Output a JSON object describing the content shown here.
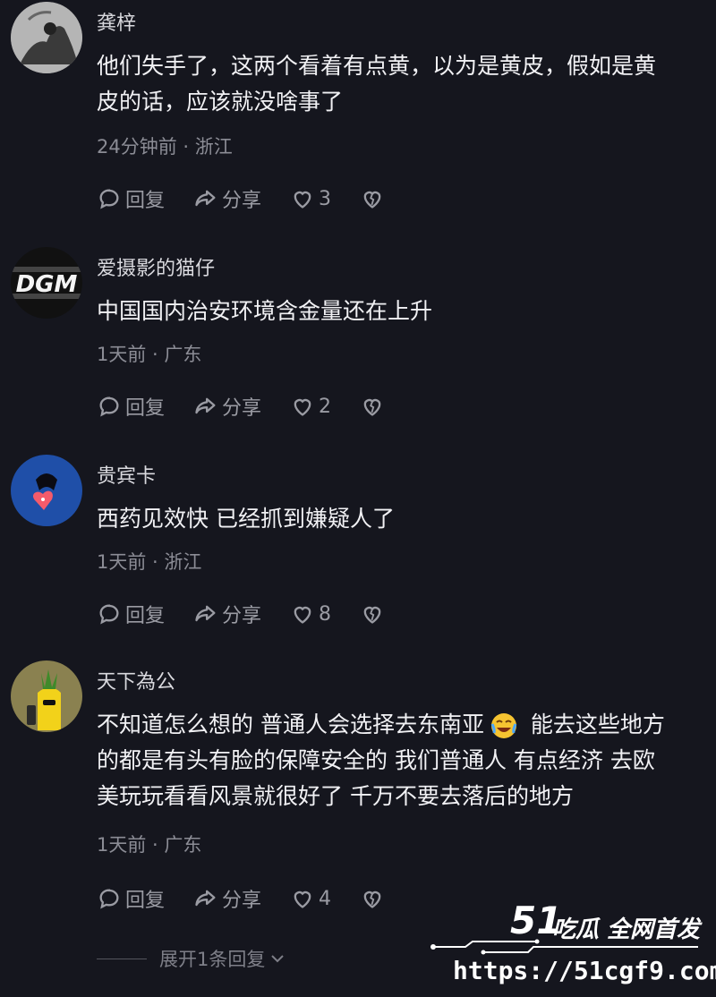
{
  "comments": [
    {
      "username": "龚梓",
      "lines": [
        "他们失手了，这两个看着有点黄，以为是黄皮，假如是黄",
        "皮的话，应该就没啥事了"
      ],
      "meta": "24分钟前 · 浙江",
      "reply_label": "回复",
      "share_label": "分享",
      "likes": "3",
      "avatar_icon": "avatar-dark-figure"
    },
    {
      "username": "爱摄影的猫仔",
      "lines": [
        "中国国内治安环境含金量还在上升"
      ],
      "meta": "1天前 · 广东",
      "reply_label": "回复",
      "share_label": "分享",
      "likes": "2",
      "avatar_text": "DGM"
    },
    {
      "username": "贵宾卡",
      "lines": [
        "西药见效快  已经抓到嫌疑人了"
      ],
      "meta": "1天前 · 浙江",
      "reply_label": "回复",
      "share_label": "分享",
      "likes": "8",
      "avatar_icon": "avatar-blue-heart"
    },
    {
      "username": "天下為公",
      "lines_part1": "不知道怎么想的 普通人会选择去东南亚",
      "lines_part2": " 能去这些地方",
      "lines": [
        "的都是有头有脸的保障安全的  我们普通人 有点经济 去欧",
        "美玩玩看看风景就很好了  千万不要去落后的地方"
      ],
      "meta": "1天前 · 广东",
      "reply_label": "回复",
      "share_label": "分享",
      "likes": "4",
      "avatar_icon": "avatar-yellow-pineapple"
    }
  ],
  "expand_replies": "展开1条回复",
  "watermark": {
    "brand_number": "51",
    "brand_text": "吃瓜 全网首发",
    "url": "https://51cgf9.com"
  },
  "colors": {
    "background": "#15161e",
    "text_primary": "#f1f1f4",
    "text_secondary": "#8b8c95"
  }
}
